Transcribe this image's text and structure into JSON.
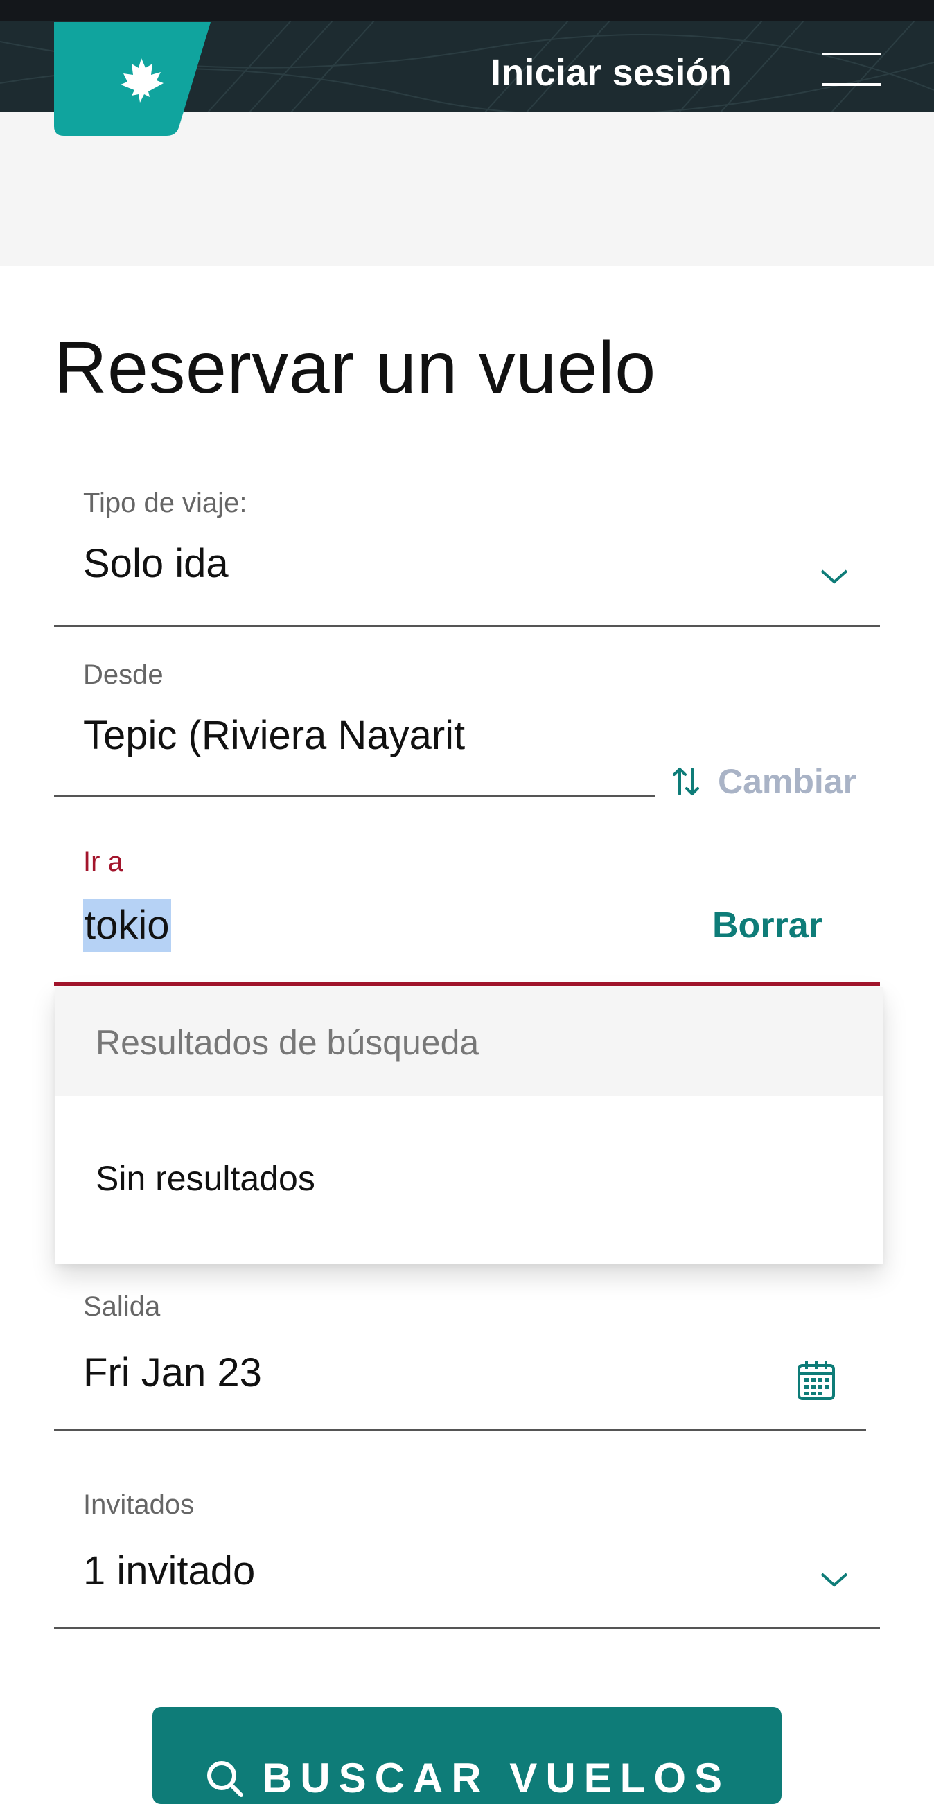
{
  "header": {
    "signin_label": "Iniciar sesión"
  },
  "colors": {
    "brand_teal": "#0e7c78",
    "header_bg": "#1d2b30",
    "error_red": "#a3152c",
    "selection_blue": "#b6d2f5",
    "swap_disabled": "#a9b3c6"
  },
  "icons": {
    "logo": "maple-leaf-icon",
    "menu": "hamburger-menu-icon",
    "chevron": "chevron-down-icon",
    "swap": "swap-arrows-icon",
    "calendar": "calendar-icon",
    "search": "search-icon"
  },
  "booking": {
    "title": "Reservar un vuelo",
    "trip_type": {
      "label": "Tipo de viaje:",
      "value": "Solo ida"
    },
    "from": {
      "label": "Desde",
      "value": "Tepic (Riviera Nayarit"
    },
    "swap_label": "Cambiar",
    "to": {
      "label": "Ir a",
      "value": "tokio",
      "clear_label": "Borrar"
    },
    "results": {
      "header": "Resultados de búsqueda",
      "empty_message": "Sin resultados"
    },
    "departure": {
      "label": "Salida",
      "value": "Fri Jan 23"
    },
    "guests": {
      "label": "Invitados",
      "value": "1 invitado"
    },
    "search_label": "BUSCAR VUELOS"
  }
}
